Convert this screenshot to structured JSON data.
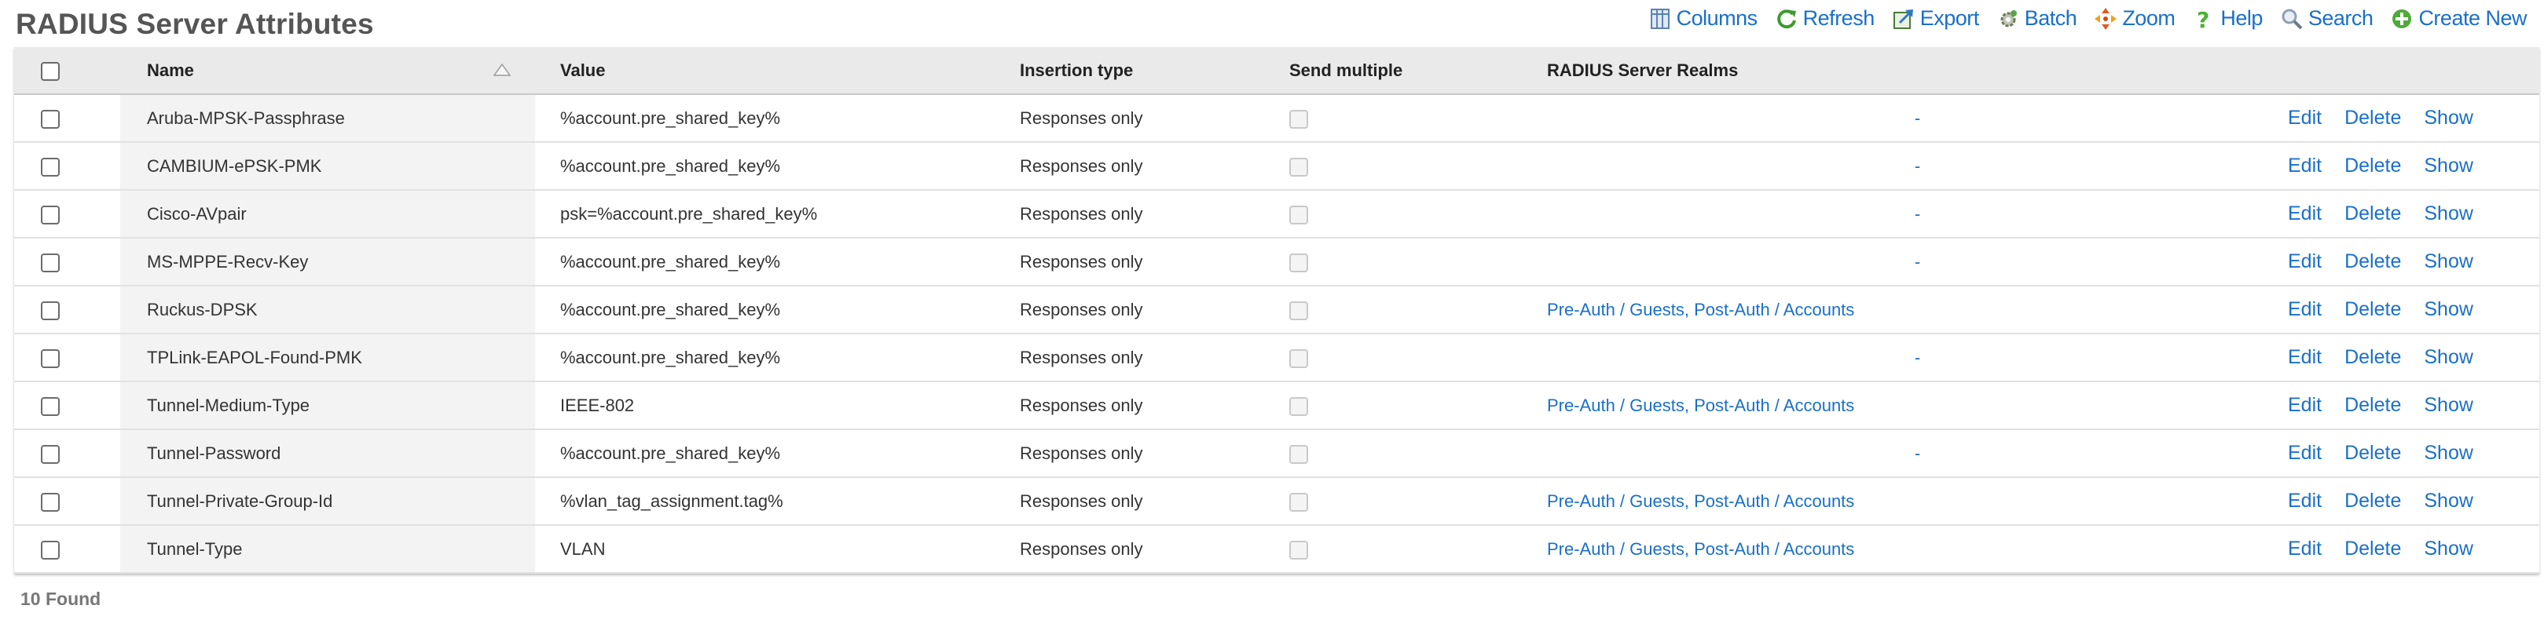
{
  "page": {
    "title": "RADIUS Server Attributes",
    "found_text": "10 Found"
  },
  "toolbar": {
    "columns": "Columns",
    "refresh": "Refresh",
    "export": "Export",
    "batch": "Batch",
    "zoom": "Zoom",
    "help": "Help",
    "search": "Search",
    "create_new": "Create New"
  },
  "colors": {
    "link": "#1a6fc9",
    "header_bg": "#eaeaea",
    "name_col_bg": "#f3f3f3",
    "title": "#555555"
  },
  "table": {
    "headers": {
      "name": "Name",
      "value": "Value",
      "insertion_type": "Insertion type",
      "send_multiple": "Send multiple",
      "realms": "RADIUS Server Realms"
    },
    "sort": {
      "column": "Name",
      "direction": "ascending",
      "icon": "sort-triangle-icon"
    },
    "action_labels": {
      "edit": "Edit",
      "delete": "Delete",
      "show": "Show"
    },
    "rows": [
      {
        "name": "Aruba-MPSK-Passphrase",
        "value": "%account.pre_shared_key%",
        "insertion": "Responses only",
        "send_multiple": false,
        "realms": "-"
      },
      {
        "name": "CAMBIUM-ePSK-PMK",
        "value": "%account.pre_shared_key%",
        "insertion": "Responses only",
        "send_multiple": false,
        "realms": "-"
      },
      {
        "name": "Cisco-AVpair",
        "value": "psk=%account.pre_shared_key%",
        "insertion": "Responses only",
        "send_multiple": false,
        "realms": "-"
      },
      {
        "name": "MS-MPPE-Recv-Key",
        "value": "%account.pre_shared_key%",
        "insertion": "Responses only",
        "send_multiple": false,
        "realms": "-"
      },
      {
        "name": "Ruckus-DPSK",
        "value": "%account.pre_shared_key%",
        "insertion": "Responses only",
        "send_multiple": false,
        "realms": "Pre-Auth / Guests, Post-Auth / Accounts"
      },
      {
        "name": "TPLink-EAPOL-Found-PMK",
        "value": "%account.pre_shared_key%",
        "insertion": "Responses only",
        "send_multiple": false,
        "realms": "-"
      },
      {
        "name": "Tunnel-Medium-Type",
        "value": "IEEE-802",
        "insertion": "Responses only",
        "send_multiple": false,
        "realms": "Pre-Auth / Guests, Post-Auth / Accounts"
      },
      {
        "name": "Tunnel-Password",
        "value": "%account.pre_shared_key%",
        "insertion": "Responses only",
        "send_multiple": false,
        "realms": "-"
      },
      {
        "name": "Tunnel-Private-Group-Id",
        "value": "%vlan_tag_assignment.tag%",
        "insertion": "Responses only",
        "send_multiple": false,
        "realms": "Pre-Auth / Guests, Post-Auth / Accounts"
      },
      {
        "name": "Tunnel-Type",
        "value": "VLAN",
        "insertion": "Responses only",
        "send_multiple": false,
        "realms": "Pre-Auth / Guests, Post-Auth / Accounts"
      }
    ]
  }
}
